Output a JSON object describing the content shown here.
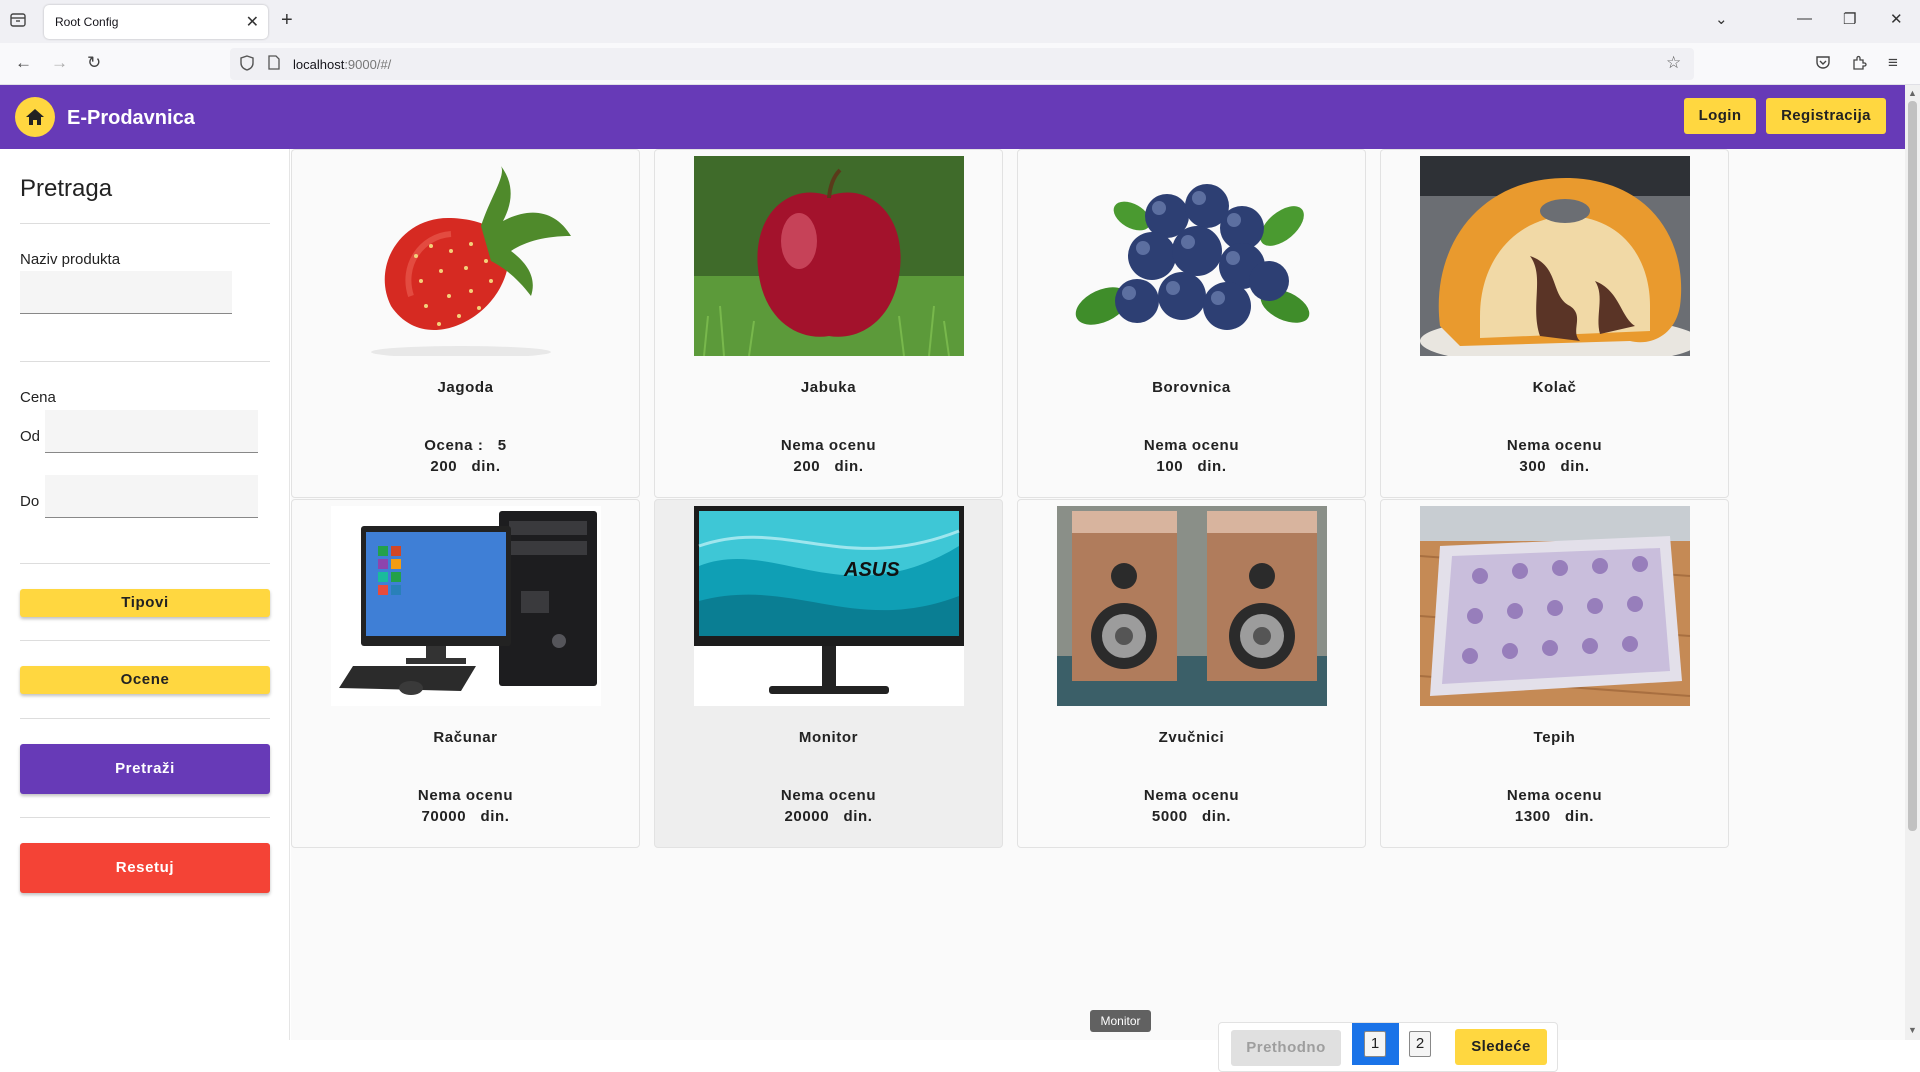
{
  "browser": {
    "tab_title": "Root Config",
    "url_host": "localhost",
    "url_rest": ":9000/#/"
  },
  "header": {
    "brand": "E-Prodavnica",
    "login_label": "Login",
    "register_label": "Registracija",
    "accent_color": "#673ab7",
    "button_color": "#ffd740"
  },
  "sidebar": {
    "title": "Pretraga",
    "product_name_label": "Naziv produkta",
    "product_name_value": "",
    "price_label": "Cena",
    "from_label": "Od",
    "from_value": "",
    "to_label": "Do",
    "to_value": "",
    "types_button": "Tipovi",
    "ratings_button": "Ocene",
    "search_button": "Pretraži",
    "reset_button": "Resetuj"
  },
  "products": [
    {
      "name": "Jagoda",
      "rating": "Ocena :   5",
      "price": "200   din.",
      "image": "strawberry"
    },
    {
      "name": "Jabuka",
      "rating": "Nema ocenu",
      "price": "200   din.",
      "image": "apple"
    },
    {
      "name": "Borovnica",
      "rating": "Nema ocenu",
      "price": "100   din.",
      "image": "blueberries"
    },
    {
      "name": "Kolač",
      "rating": "Nema ocenu",
      "price": "300   din.",
      "image": "cake"
    },
    {
      "name": "Računar",
      "rating": "Nema ocenu",
      "price": "70000   din.",
      "image": "computer"
    },
    {
      "name": "Monitor",
      "rating": "Nema ocenu",
      "price": "20000   din.",
      "image": "monitor"
    },
    {
      "name": "Zvučnici",
      "rating": "Nema ocenu",
      "price": "5000   din.",
      "image": "speakers"
    },
    {
      "name": "Tepih",
      "rating": "Nema ocenu",
      "price": "1300   din.",
      "image": "carpet"
    }
  ],
  "tooltip": "Monitor",
  "pagination": {
    "prev_label": "Prethodno",
    "pages": [
      "1",
      "2"
    ],
    "current_page": "1",
    "next_label": "Sledeće"
  }
}
